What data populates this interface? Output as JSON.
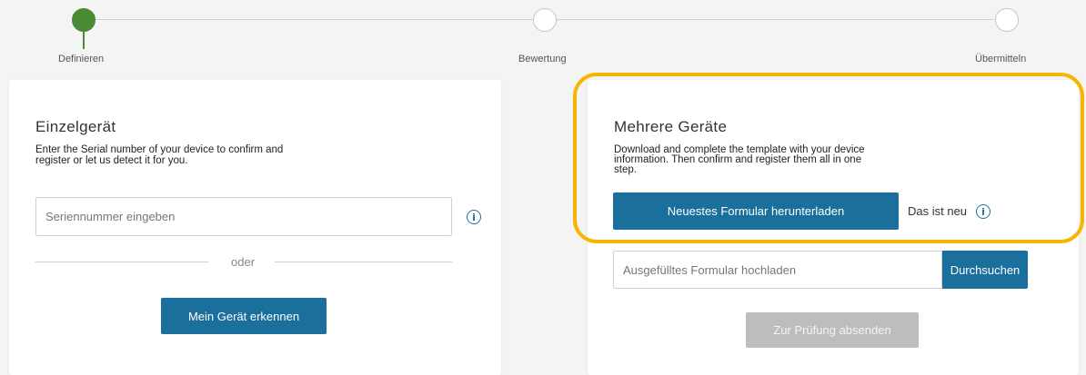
{
  "stepper": {
    "steps": [
      {
        "label": "Definieren",
        "state": "active"
      },
      {
        "label": "Bewertung",
        "state": "inactive"
      },
      {
        "label": "Übermitteln",
        "state": "inactive"
      }
    ]
  },
  "single_device": {
    "title": "Einzelgerät",
    "description_line1": "Enter the Serial number of your device to confirm and",
    "description_line2": "register or let us detect it for you.",
    "serial_input_placeholder": "Seriennummer eingeben",
    "info_icon": "info-icon",
    "divider_text": "oder",
    "detect_button": "Mein Gerät erkennen"
  },
  "multiple_devices": {
    "title": "Mehrere Geräte",
    "description_line1": "Download and complete the template with your device",
    "description_line2": "information. Then confirm and register them all in one",
    "description_line3": "step.",
    "download_button": "Neuestes Formular herunterladen",
    "new_label": "Das ist neu",
    "info_icon": "info-icon",
    "upload_input_placeholder": "Ausgefülltes Formular hochladen",
    "browse_button": "Durchsuchen",
    "submit_button": "Zur Prüfung absenden"
  },
  "colors": {
    "accent": "#1a6f9c",
    "step_active": "#4a8a35",
    "highlight": "#f7b500",
    "disabled": "#bdbdbd"
  }
}
